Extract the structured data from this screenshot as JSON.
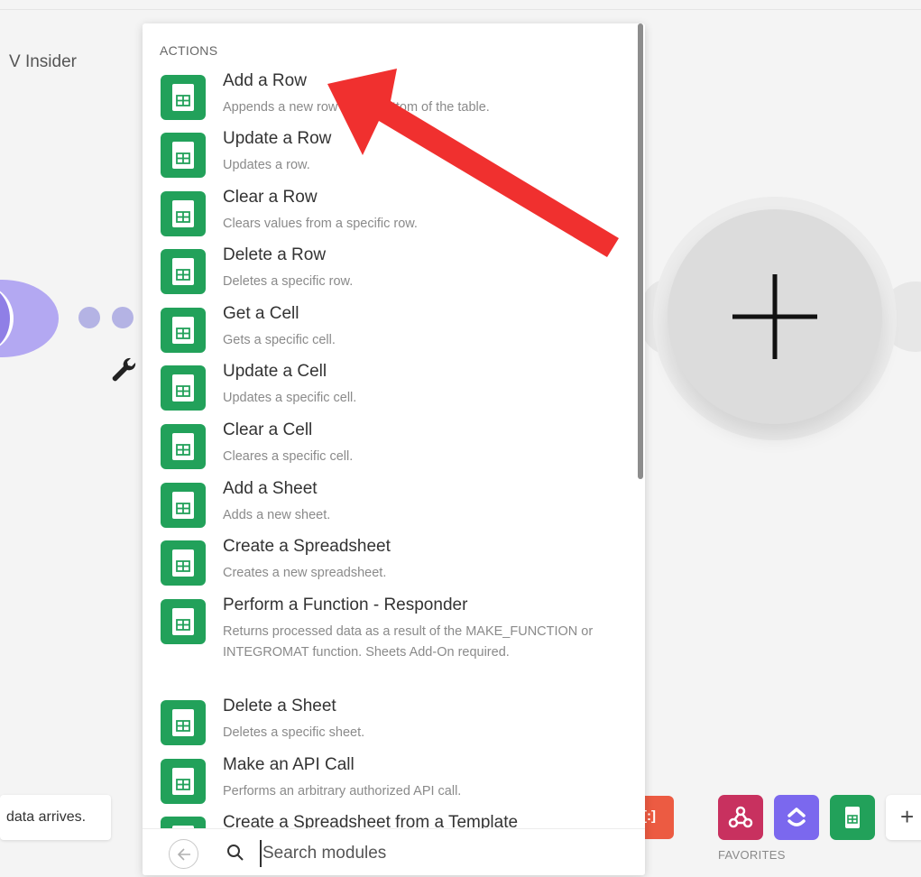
{
  "scenario": {
    "label": "V Insider"
  },
  "panel": {
    "section_label": "ACTIONS",
    "actions": [
      {
        "title": "Add a Row",
        "desc": "Appends a new row to the bottom of the table."
      },
      {
        "title": "Update a Row",
        "desc": "Updates a row."
      },
      {
        "title": "Clear a Row",
        "desc": "Clears values from a specific row."
      },
      {
        "title": "Delete a Row",
        "desc": "Deletes a specific row."
      },
      {
        "title": "Get a Cell",
        "desc": "Gets a specific cell."
      },
      {
        "title": "Update a Cell",
        "desc": "Updates a specific cell."
      },
      {
        "title": "Clear a Cell",
        "desc": "Cleares a specific cell."
      },
      {
        "title": "Add a Sheet",
        "desc": "Adds a new sheet."
      },
      {
        "title": "Create a Spreadsheet",
        "desc": "Creates a new spreadsheet."
      },
      {
        "title": "Perform a Function - Responder",
        "desc": "Returns processed data as a result of the MAKE_FUNCTION or INTEGROMAT function. Sheets Add-On required."
      },
      {
        "title": "Delete a Sheet",
        "desc": "Deletes a specific sheet."
      },
      {
        "title": "Make an API Call",
        "desc": "Performs an arbitrary authorized API call."
      },
      {
        "title": "Create a Spreadsheet from a Template",
        "desc": ""
      }
    ],
    "search_placeholder": "Search modules"
  },
  "bottom": {
    "tooltip_text": "data arrives.",
    "orange_chip_text": "[:]",
    "favorites_label": "FAVORITES",
    "favorites": [
      {
        "icon": "webhook-icon",
        "color": "#c8315f"
      },
      {
        "icon": "clickup-icon",
        "color": "#7b68ee"
      },
      {
        "icon": "google-sheets-icon",
        "color": "#22a15a"
      }
    ],
    "add_favorite": "+"
  },
  "colors": {
    "sheets_green": "#22a15a",
    "annotation_red": "#f0302f",
    "module_purple": "#b3a8f2"
  }
}
